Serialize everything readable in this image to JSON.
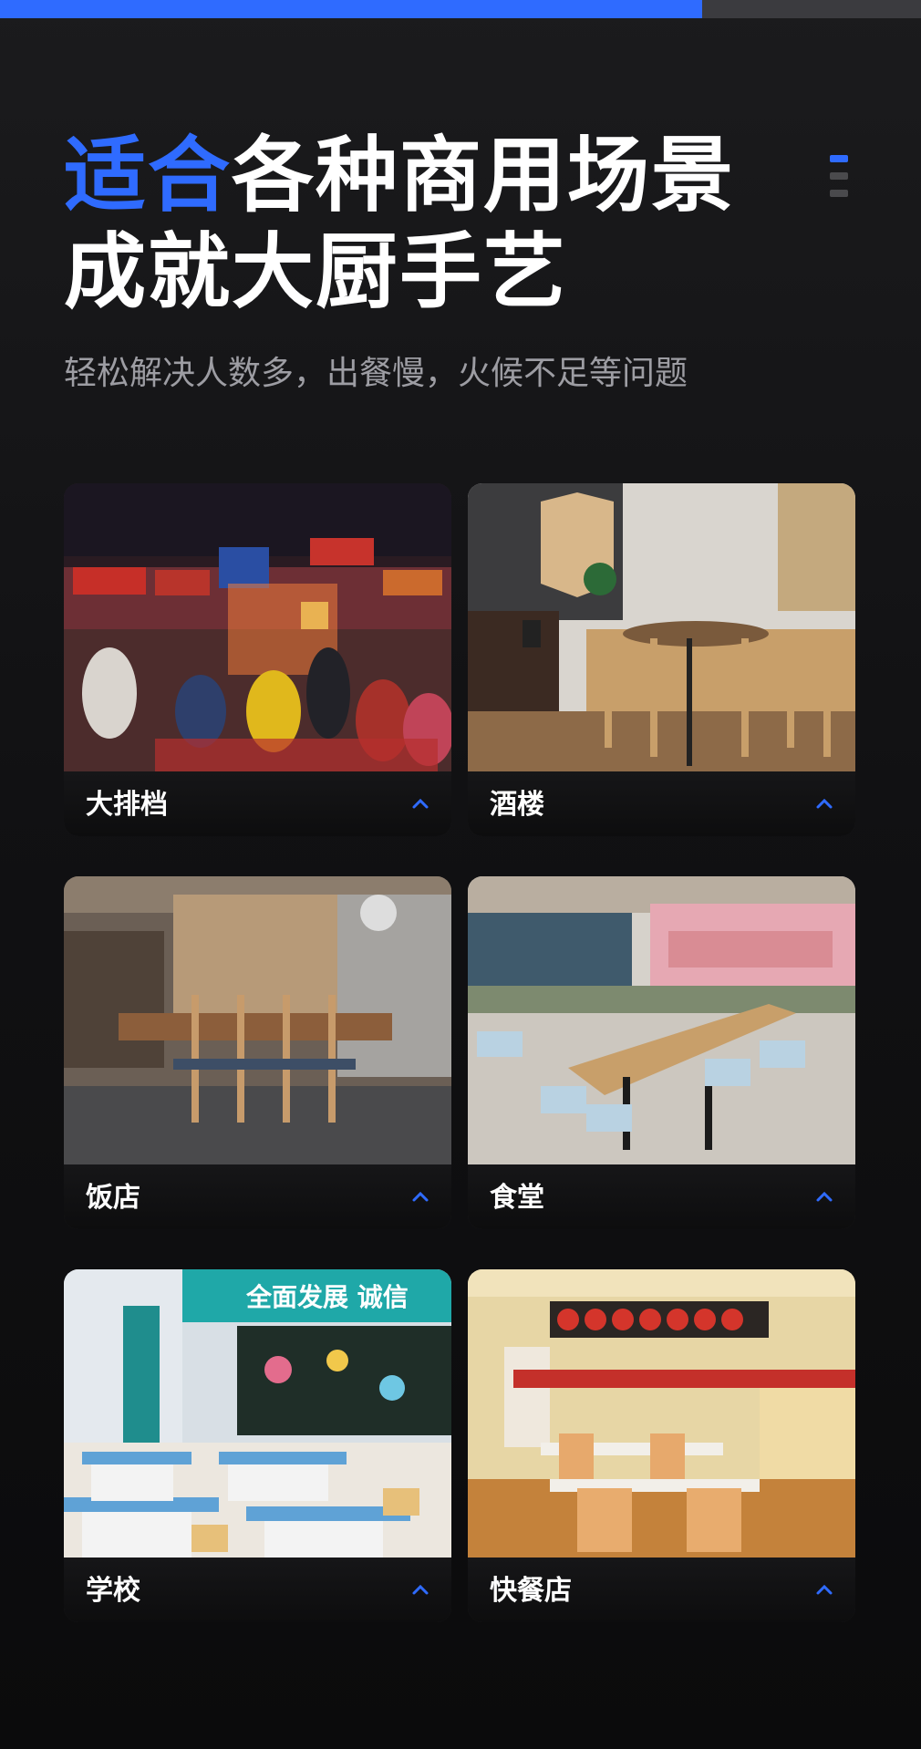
{
  "progress": {
    "value": 0.762,
    "fill_color": "#2f6bff",
    "track_color": "#3b3b3f"
  },
  "headline": {
    "accent_text": "适合",
    "line1_rest": "各种商用场景",
    "line2": "成就大厨手艺"
  },
  "subtitle": "轻松解决人数多，出餐慢，火候不足等问题",
  "menu_icon": {
    "icon": "menu-icon",
    "accent_color": "#2f6bff"
  },
  "scenes": [
    {
      "label": "大排档",
      "icon": "chevron-up-icon"
    },
    {
      "label": "酒楼",
      "icon": "chevron-up-icon"
    },
    {
      "label": "饭店",
      "icon": "chevron-up-icon"
    },
    {
      "label": "食堂",
      "icon": "chevron-up-icon"
    },
    {
      "label": "学校",
      "icon": "chevron-up-icon"
    },
    {
      "label": "快餐店",
      "icon": "chevron-up-icon"
    }
  ],
  "chalkboard": {
    "banner": "全面发展   诚信"
  },
  "colors": {
    "accent": "#2f6bff",
    "background": "#111113",
    "subtitle": "#9d9da3"
  }
}
